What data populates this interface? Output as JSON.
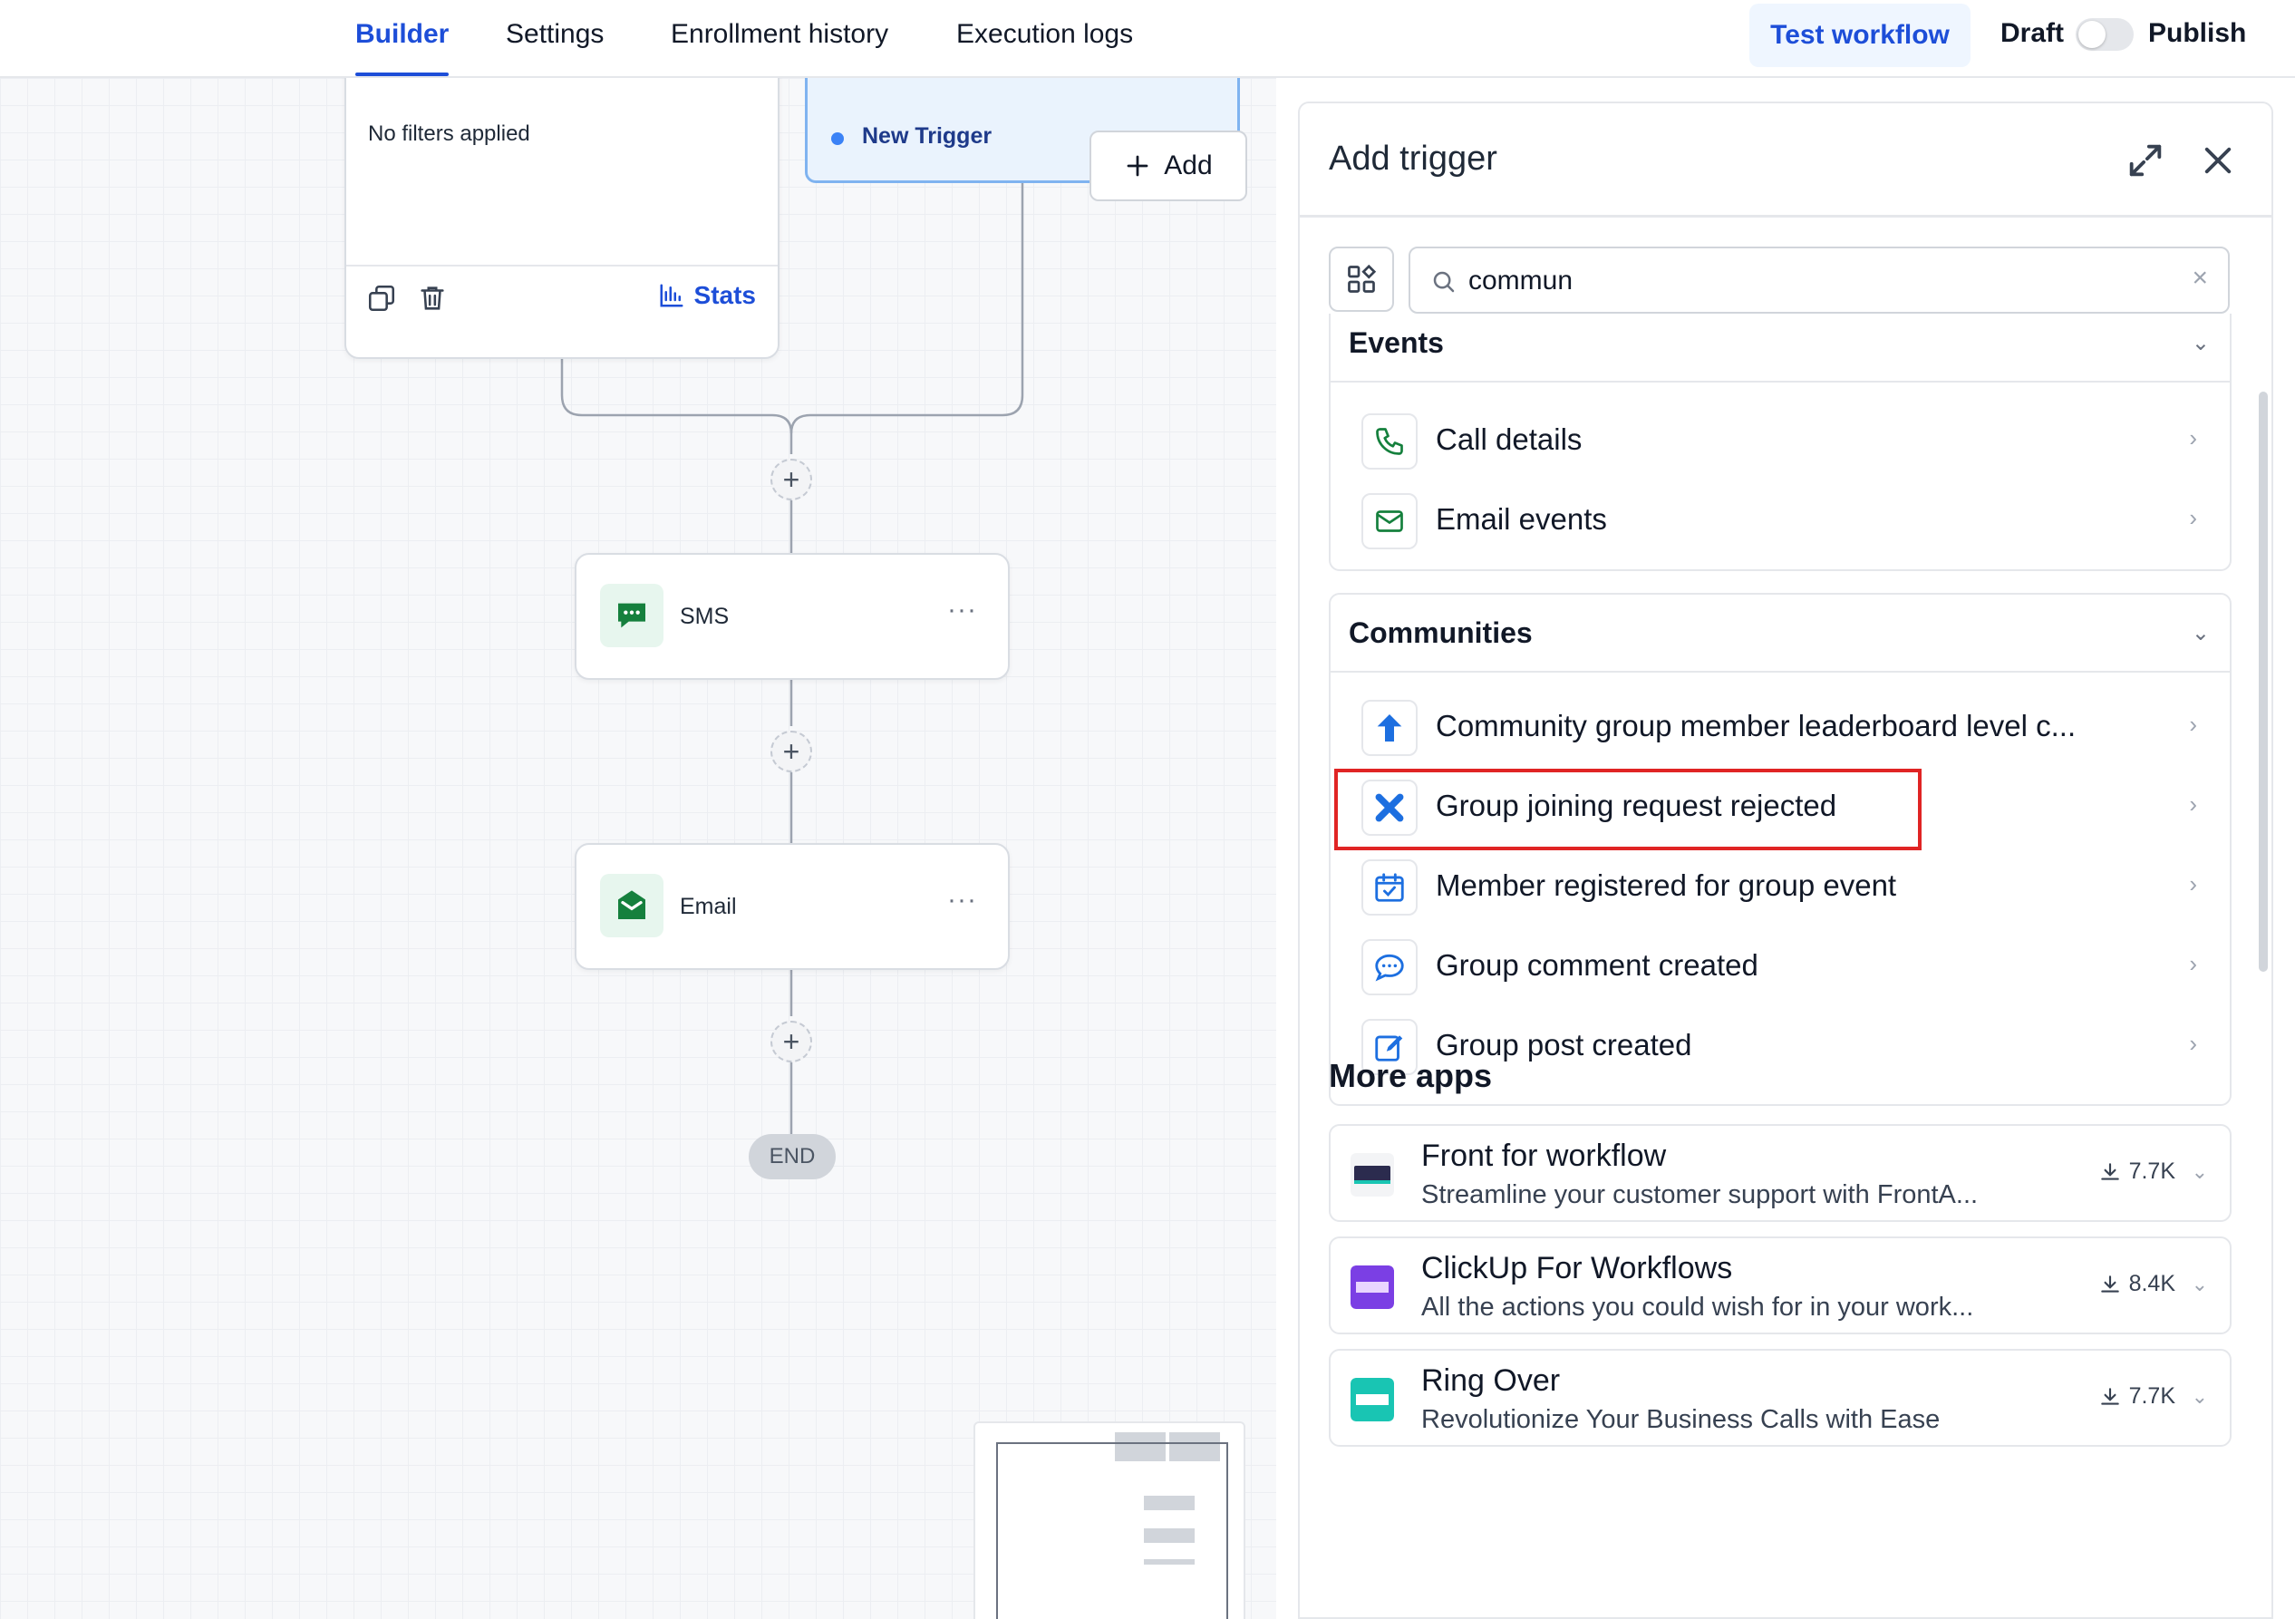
{
  "tabs": [
    {
      "label": "Builder",
      "active": true
    },
    {
      "label": "Settings",
      "active": false
    },
    {
      "label": "Enrollment history",
      "active": false
    },
    {
      "label": "Execution logs",
      "active": false
    }
  ],
  "header_actions": {
    "test_workflow": "Test workflow",
    "draft": "Draft",
    "publish": "Publish",
    "publish_toggle_on": false
  },
  "canvas": {
    "filter_card": {
      "text": "No filters applied",
      "stats_label": "Stats",
      "copy_icon": "copy-icon",
      "delete_icon": "trash-icon",
      "stats_icon": "bar-chart-icon"
    },
    "trigger_card": {
      "label": "New Trigger"
    },
    "add_button": "Add",
    "actions": [
      {
        "name": "SMS",
        "icon": "sms-icon"
      },
      {
        "name": "Email",
        "icon": "email-icon"
      }
    ],
    "end_label": "END",
    "more_symbol": "···",
    "plus_symbol": "+"
  },
  "panel": {
    "title": "Add trigger",
    "search": {
      "value": "commun",
      "placeholder": ""
    },
    "sections": [
      {
        "title": "Events",
        "items": [
          {
            "label": "Call details",
            "icon": "phone-icon"
          },
          {
            "label": "Email events",
            "icon": "mail-icon"
          }
        ]
      },
      {
        "title": "Communities",
        "items": [
          {
            "label": "Community group member leaderboard level c...",
            "icon": "arrow-up-icon"
          },
          {
            "label": "Group joining request rejected",
            "icon": "x-mark-icon",
            "highlighted": true
          },
          {
            "label": "Member registered for group event",
            "icon": "calendar-check-icon"
          },
          {
            "label": "Group comment created",
            "icon": "comment-icon"
          },
          {
            "label": "Group post created",
            "icon": "edit-icon"
          }
        ]
      }
    ],
    "more_apps_title": "More apps",
    "apps": [
      {
        "title": "Front for workflow",
        "description": "Streamline your customer support with FrontA...",
        "downloads": "7.7K",
        "logo_color": "#2b2b4e"
      },
      {
        "title": "ClickUp For Workflows",
        "description": "All the actions you could wish for in your work...",
        "downloads": "8.4K",
        "logo_color": "#7b3fe4"
      },
      {
        "title": "Ring Over",
        "description": "Revolutionize Your Business Calls with Ease",
        "downloads": "7.7K",
        "logo_color": "#19c5b3"
      }
    ]
  },
  "colors": {
    "accent": "#1d4ed8",
    "highlight": "#e02424",
    "green": "#15803d"
  }
}
